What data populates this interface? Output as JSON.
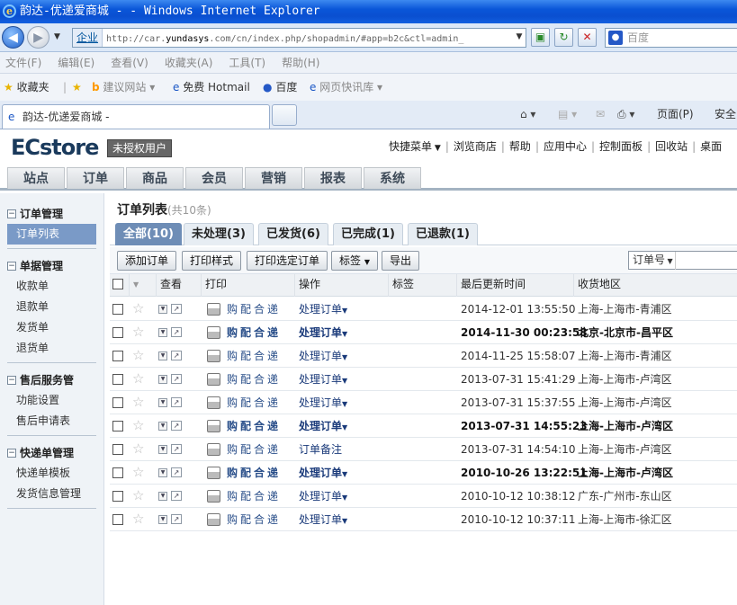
{
  "browser": {
    "title": "韵达-优递爱商城 - - Windows Internet Explorer",
    "zone": "企业",
    "url_prefix": "http://car.",
    "url_domain": "yundasys",
    "url_suffix": ".com/cn/index.php/shopadmin/#app=b2c&ctl=admin_",
    "search_placeholder": "百度",
    "menu": [
      "文件(F)",
      "编辑(E)",
      "查看(V)",
      "收藏夹(A)",
      "工具(T)",
      "帮助(H)"
    ],
    "favorites": {
      "label": "收藏夹",
      "items": [
        "建议网站",
        "免费 Hotmail",
        "百度",
        "网页快讯库"
      ]
    },
    "tab_title": "韵达-优递爱商城 -",
    "commands": [
      "页面(P)",
      "安全"
    ]
  },
  "app": {
    "logo": "ECstore",
    "license_badge": "未授权用户",
    "quick_links": [
      "快捷菜单",
      "浏览商店",
      "帮助",
      "应用中心",
      "控制面板",
      "回收站",
      "桌面"
    ],
    "nav_tabs": [
      "站点",
      "订单",
      "商品",
      "会员",
      "营销",
      "报表",
      "系统"
    ]
  },
  "sidebar": {
    "groups": [
      {
        "title": "订单管理",
        "items": [
          "订单列表"
        ]
      },
      {
        "title": "单据管理",
        "items": [
          "收款单",
          "退款单",
          "发货单",
          "退货单"
        ]
      },
      {
        "title": "售后服务管",
        "items": [
          "功能设置",
          "售后申请表"
        ]
      },
      {
        "title": "快递单管理",
        "items": [
          "快递单模板",
          "发货信息管理"
        ]
      }
    ]
  },
  "main": {
    "title": "订单列表",
    "count": "(共10条)",
    "filter_tabs": [
      "全部(10)",
      "未处理(3)",
      "已发货(6)",
      "已完成(1)",
      "已退款(1)"
    ],
    "actions": [
      "添加订单",
      "打印样式",
      "打印选定订单",
      "标签",
      "导出"
    ],
    "filter_field": "订单号",
    "columns": [
      "查看",
      "打印",
      "操作",
      "标签",
      "最后更新时间",
      "收货地区"
    ],
    "rows": [
      {
        "print": "购配合递",
        "op": "处理订单",
        "time": "2014-12-01 13:55:50",
        "area": "上海-上海市-青浦区",
        "bold": false,
        "op_dropdown": true
      },
      {
        "print": "购配合递",
        "op": "处理订单",
        "time": "2014-11-30 00:23:58",
        "area": "北京-北京市-昌平区",
        "bold": true,
        "op_dropdown": true
      },
      {
        "print": "购配合递",
        "op": "处理订单",
        "time": "2014-11-25 15:58:07",
        "area": "上海-上海市-青浦区",
        "bold": false,
        "op_dropdown": true
      },
      {
        "print": "购配合递",
        "op": "处理订单",
        "time": "2013-07-31 15:41:29",
        "area": "上海-上海市-卢湾区",
        "bold": false,
        "op_dropdown": true
      },
      {
        "print": "购配合递",
        "op": "处理订单",
        "time": "2013-07-31 15:37:55",
        "area": "上海-上海市-卢湾区",
        "bold": false,
        "op_dropdown": true
      },
      {
        "print": "购配合递",
        "op": "处理订单",
        "time": "2013-07-31 14:55:23",
        "area": "上海-上海市-卢湾区",
        "bold": true,
        "op_dropdown": true
      },
      {
        "print": "购配合递",
        "op": "订单备注",
        "time": "2013-07-31 14:54:10",
        "area": "上海-上海市-卢湾区",
        "bold": false,
        "op_dropdown": false
      },
      {
        "print": "购配合递",
        "op": "处理订单",
        "time": "2010-10-26 13:22:51",
        "area": "上海-上海市-卢湾区",
        "bold": true,
        "op_dropdown": true
      },
      {
        "print": "购配合递",
        "op": "处理订单",
        "time": "2010-10-12 10:38:12",
        "area": "广东-广州市-东山区",
        "bold": false,
        "op_dropdown": true
      },
      {
        "print": "购配合递",
        "op": "处理订单",
        "time": "2010-10-12 10:37:11",
        "area": "上海-上海市-徐汇区",
        "bold": false,
        "op_dropdown": true
      }
    ]
  }
}
